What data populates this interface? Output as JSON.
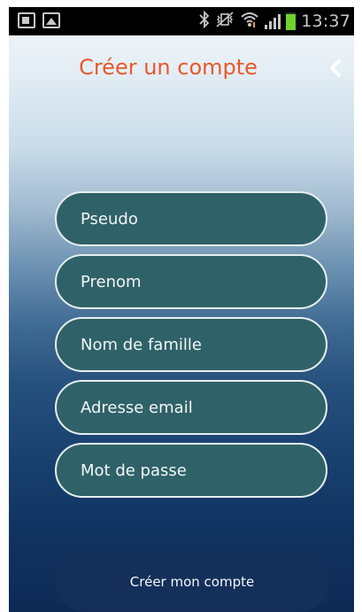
{
  "status_bar": {
    "left_icons": [
      "outlook-notification-icon",
      "image-notification-icon"
    ],
    "right_icons": [
      "bluetooth-icon",
      "vibrate-mute-icon",
      "wifi-icon",
      "signal-icon",
      "battery-icon"
    ],
    "time": "13:37",
    "battery_color": "#6fd12e"
  },
  "header": {
    "title": "Créer un compte",
    "title_color": "#e8582b",
    "back_icon": "chevron-left-icon"
  },
  "form": {
    "fields": [
      {
        "placeholder": "Pseudo"
      },
      {
        "placeholder": "Prenom"
      },
      {
        "placeholder": "Nom de famille"
      },
      {
        "placeholder": "Adresse email"
      },
      {
        "placeholder": "Mot de passe"
      }
    ],
    "field_color": "#2f6268",
    "submit_label": "Créer mon compte",
    "submit_color": "#14305a"
  }
}
